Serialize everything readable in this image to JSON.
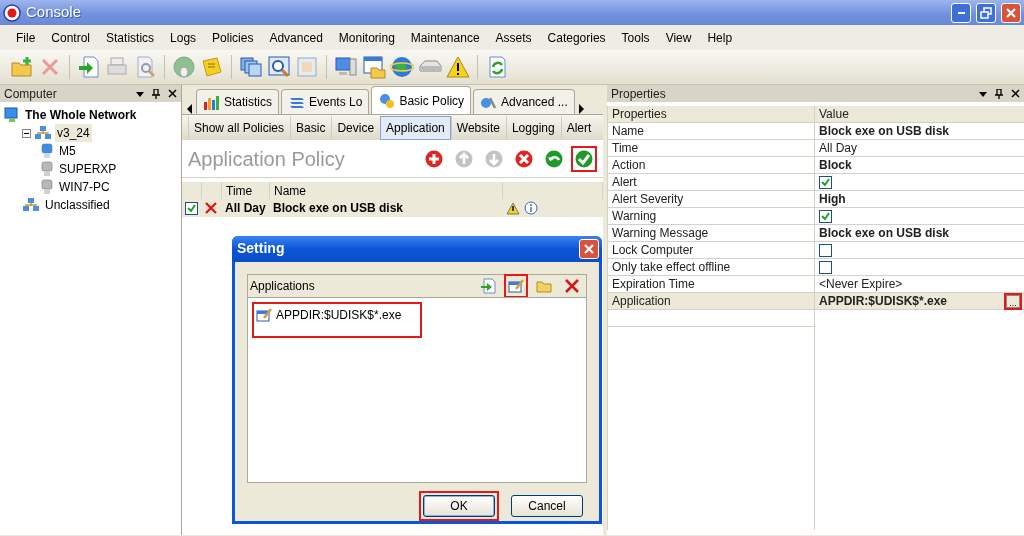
{
  "window": {
    "title": "Console"
  },
  "menu": [
    "File",
    "Control",
    "Statistics",
    "Logs",
    "Policies",
    "Advanced",
    "Monitoring",
    "Maintenance",
    "Assets",
    "Categories",
    "Tools",
    "View",
    "Help"
  ],
  "computer_panel": {
    "title": "Computer",
    "tree": [
      {
        "label": "The Whole Network",
        "kind": "network",
        "selected": false,
        "children": [
          {
            "label": "v3_24",
            "kind": "group",
            "selected": true,
            "children": [
              {
                "label": "M5",
                "kind": "computer",
                "online": true,
                "selected": false
              },
              {
                "label": "SUPERXP",
                "kind": "computer",
                "online": false,
                "selected": false
              },
              {
                "label": "WIN7-PC",
                "kind": "computer",
                "online": false,
                "selected": false
              }
            ]
          },
          {
            "label": "Unclassified",
            "kind": "group",
            "selected": false
          }
        ]
      }
    ]
  },
  "tabs": [
    {
      "label": "Statistics",
      "selected": false
    },
    {
      "label": "Events Lo",
      "selected": false
    },
    {
      "label": "Basic Policy",
      "selected": true
    },
    {
      "label": "Advanced ...",
      "selected": false
    }
  ],
  "subtabs": [
    {
      "label": "Show all Policies",
      "selected": false
    },
    {
      "label": "Basic",
      "selected": false
    },
    {
      "label": "Device",
      "selected": false
    },
    {
      "label": "Application",
      "selected": true
    },
    {
      "label": "Website",
      "selected": false
    },
    {
      "label": "Logging",
      "selected": false
    },
    {
      "label": "Alert",
      "selected": false
    }
  ],
  "policy": {
    "title": "Application Policy",
    "actions": [
      {
        "kind": "add",
        "disabled": false,
        "highlighted": false
      },
      {
        "kind": "up",
        "disabled": true,
        "highlighted": false
      },
      {
        "kind": "down",
        "disabled": true,
        "highlighted": false
      },
      {
        "kind": "delete",
        "disabled": false,
        "highlighted": false
      },
      {
        "kind": "undo",
        "disabled": false,
        "highlighted": false
      },
      {
        "kind": "apply",
        "disabled": false,
        "highlighted": true
      }
    ],
    "columns": [
      "Time",
      "Name"
    ],
    "rows": [
      {
        "checked": true,
        "time": "All Day",
        "name": "Block exe on USB disk"
      }
    ]
  },
  "properties_panel": {
    "title": "Properties",
    "columns": [
      "Properties",
      "Value"
    ],
    "rows": [
      {
        "name": "Name",
        "kind": "text",
        "value": "Block exe on USB disk",
        "bold": true,
        "selected": false
      },
      {
        "name": "Time",
        "kind": "text",
        "value": "All Day",
        "bold": false,
        "selected": false
      },
      {
        "name": "Action",
        "kind": "text",
        "value": "Block",
        "bold": true,
        "selected": false
      },
      {
        "name": "Alert",
        "kind": "check",
        "checked": true,
        "selected": false
      },
      {
        "name": "Alert Severity",
        "kind": "text",
        "value": "High",
        "bold": true,
        "selected": false
      },
      {
        "name": "Warning",
        "kind": "check",
        "checked": true,
        "selected": false
      },
      {
        "name": "Warning Message",
        "kind": "text",
        "value": "Block exe on USB disk",
        "bold": true,
        "selected": false
      },
      {
        "name": "Lock Computer",
        "kind": "check",
        "checked": false,
        "selected": false
      },
      {
        "name": "Only take effect offline",
        "kind": "check",
        "checked": false,
        "selected": false
      },
      {
        "name": "Expiration Time",
        "kind": "text",
        "value": "<Never Expire>",
        "bold": false,
        "selected": false
      },
      {
        "name": "Application",
        "kind": "browse",
        "value": "APPDIR:$UDISK$*.exe",
        "bold": true,
        "selected": true,
        "button": "...",
        "highlighted": true
      }
    ]
  },
  "dialog": {
    "title": "Setting",
    "list_label": "Applications",
    "tools": [
      {
        "kind": "import",
        "highlighted": false
      },
      {
        "kind": "edit",
        "highlighted": true
      },
      {
        "kind": "folder",
        "highlighted": false
      },
      {
        "kind": "delete",
        "highlighted": false
      }
    ],
    "items": [
      {
        "label": "APPDIR:$UDISK$*.exe",
        "highlighted": true
      }
    ],
    "buttons": [
      {
        "label": "OK",
        "default": true,
        "highlighted": true
      },
      {
        "label": "Cancel",
        "default": false,
        "highlighted": false
      }
    ]
  }
}
